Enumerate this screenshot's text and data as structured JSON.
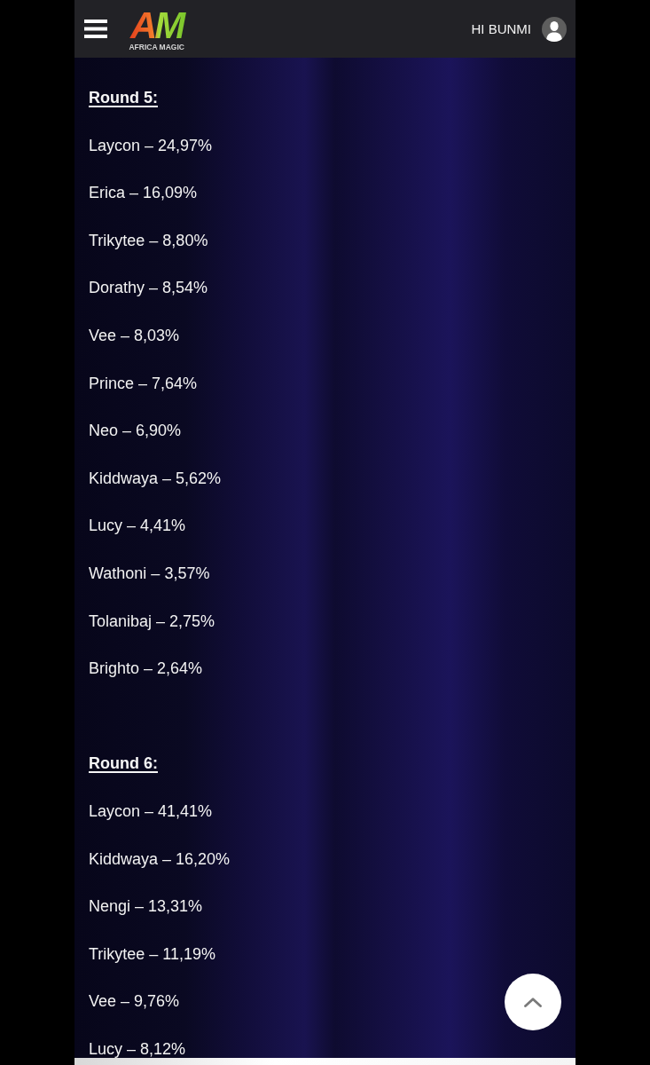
{
  "header": {
    "logo": {
      "mark": "AM",
      "caption": "AFRICA MAGIC"
    },
    "greeting": "HI BUNMI"
  },
  "sections": [
    {
      "heading": "Round 5:",
      "results": [
        "Laycon – 24,97%",
        "Erica – 16,09%",
        "Trikytee – 8,80%",
        "Dorathy – 8,54%",
        "Vee – 8,03%",
        "Prince – 7,64%",
        "Neo – 6,90%",
        "Kiddwaya – 5,62%",
        "Lucy – 4,41%",
        "Wathoni – 3,57%",
        "Tolanibaj – 2,75%",
        "Brighto – 2,64%"
      ]
    },
    {
      "heading": "Round 6:",
      "results": [
        "Laycon – 41,41%",
        "Kiddwaya – 16,20%",
        "Nengi – 13,31%",
        "Trikytee – 11,19%",
        "Vee – 9,76%",
        "Lucy – 8,12%"
      ]
    }
  ]
}
